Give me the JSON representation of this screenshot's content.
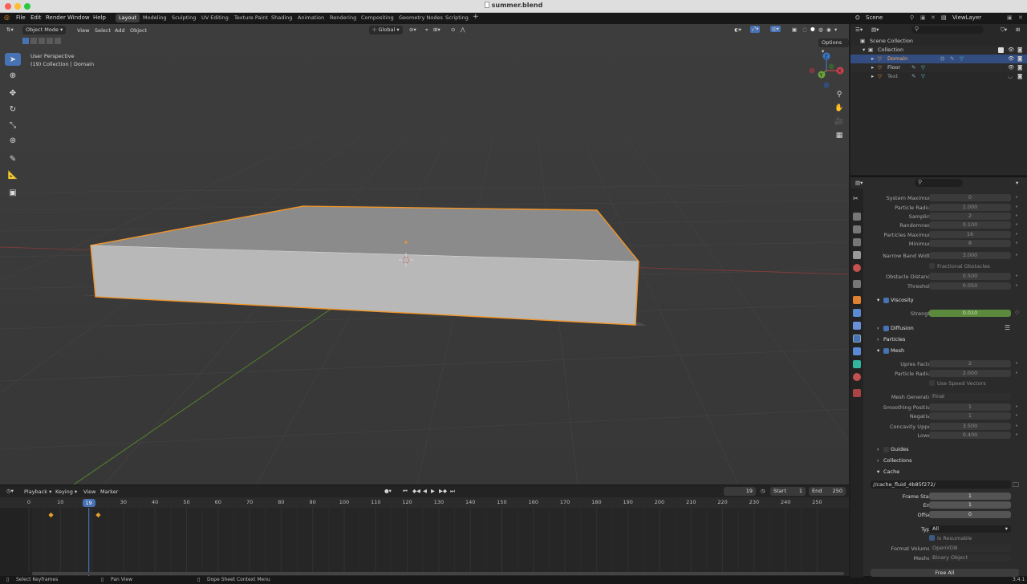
{
  "window": {
    "title": "summer.blend"
  },
  "menu": [
    "File",
    "Edit",
    "Render",
    "Window",
    "Help"
  ],
  "workspaces": [
    "Layout",
    "Modeling",
    "Sculpting",
    "UV Editing",
    "Texture Paint",
    "Shading",
    "Animation",
    "Rendering",
    "Compositing",
    "Geometry Nodes",
    "Scripting"
  ],
  "topright": {
    "scene": "Scene",
    "viewlayer": "ViewLayer"
  },
  "viewport": {
    "mode": "Object Mode",
    "menus": [
      "View",
      "Select",
      "Add",
      "Object"
    ],
    "orientation": "Global",
    "options": "Options",
    "perspective": "User Perspective",
    "collection": "(19) Collection | Domain",
    "gizmo": {
      "z": "Z",
      "x": "X",
      "y": "Y"
    }
  },
  "timeline": {
    "menus": [
      "Playback",
      "Keying",
      "View",
      "Marker"
    ],
    "current_frame": "19",
    "start_label": "Start",
    "start": "1",
    "end_label": "End",
    "end": "250",
    "ticks": [
      "0",
      "10",
      "20",
      "30",
      "40",
      "50",
      "60",
      "70",
      "80",
      "90",
      "100",
      "110",
      "120",
      "130",
      "140",
      "150",
      "160",
      "170",
      "180",
      "190",
      "200",
      "210",
      "220",
      "230",
      "240",
      "250"
    ],
    "keyframes": [
      7,
      22
    ]
  },
  "outliner": {
    "root": "Scene Collection",
    "collection": "Collection",
    "objects": [
      "Domain",
      "Floor",
      "Text"
    ]
  },
  "properties": {
    "rows1": [
      {
        "label": "System Maximum",
        "value": "0"
      },
      {
        "label": "Particle Radius",
        "value": "1.000"
      },
      {
        "label": "Sampling",
        "value": "2"
      },
      {
        "label": "Randomness",
        "value": "0.100"
      },
      {
        "label": "Particles Maximum",
        "value": "16"
      },
      {
        "label": "Minimum",
        "value": "8"
      },
      {
        "label": "Narrow Band Width",
        "value": "3.000"
      }
    ],
    "fractional_obstacles": "Fractional Obstacles",
    "rows2": [
      {
        "label": "Obstacle Distance",
        "value": "0.500"
      },
      {
        "label": "Threshold",
        "value": "0.050"
      }
    ],
    "viscosity": "Viscosity",
    "strength": {
      "label": "Strength",
      "value": "0.010"
    },
    "diffusion": "Diffusion",
    "particles": "Particles",
    "mesh": "Mesh",
    "rows3": [
      {
        "label": "Upres Factor",
        "value": "2"
      },
      {
        "label": "Particle Radius",
        "value": "2.000"
      }
    ],
    "use_speed_vectors": "Use Speed Vectors",
    "mesh_generator": {
      "label": "Mesh Generator",
      "value": "Final"
    },
    "rows4": [
      {
        "label": "Smoothing Positive",
        "value": "1"
      },
      {
        "label": "Negative",
        "value": "1"
      },
      {
        "label": "Concavity Upper",
        "value": "3.500"
      },
      {
        "label": "Lower",
        "value": "0.400"
      }
    ],
    "guides": "Guides",
    "collections": "Collections",
    "cache": "Cache",
    "cache_path": "//cache_fluid_4b85f272/",
    "frame_start": {
      "label": "Frame Start",
      "value": "1"
    },
    "end": {
      "label": "End",
      "value": "1"
    },
    "offset": {
      "label": "Offset",
      "value": "0"
    },
    "type": {
      "label": "Type",
      "value": "All"
    },
    "is_resumable": "Is Resumable",
    "format_volumes": {
      "label": "Format Volumes",
      "value": "OpenVDB"
    },
    "meshes": {
      "label": "Meshes",
      "value": "Binary Object"
    },
    "free_all": "Free All"
  },
  "status": {
    "left": "Select Keyframes",
    "mid": "Pan View",
    "right": "Dope Sheet Context Menu",
    "version": "3.4.1"
  }
}
